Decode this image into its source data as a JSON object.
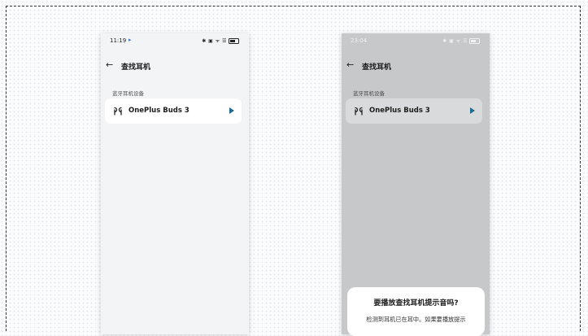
{
  "phones": [
    {
      "status": {
        "time": "11:19",
        "icons": "✱ ▣ ᯤ ☰"
      },
      "title": "查找耳机",
      "section_label": "蓝牙耳机设备",
      "device": {
        "name": "OnePlus Buds 3",
        "icon": "earbuds-icon",
        "action_icon": "play-icon"
      }
    },
    {
      "status": {
        "time": "23:04",
        "icons": "✱ ▣ ᯤ ☰"
      },
      "title": "查找耳机",
      "section_label": "蓝牙耳机设备",
      "device": {
        "name": "OnePlus Buds 3",
        "icon": "earbuds-icon",
        "action_icon": "play-icon"
      }
    }
  ],
  "dialog": {
    "title": "要播放查找耳机提示音吗?",
    "body": "检测到耳机已在耳中。如果要播放提示"
  },
  "colors": {
    "accent": "#1d6d93",
    "dim_overlay": "#c6c8ca",
    "card": "#ffffff"
  }
}
